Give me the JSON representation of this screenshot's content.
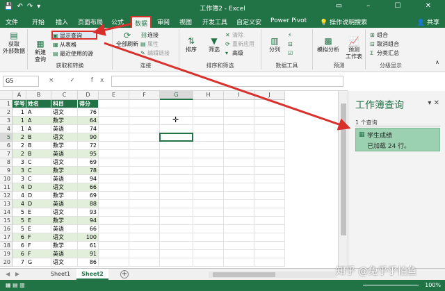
{
  "window": {
    "title": "工作簿2 - Excel"
  },
  "tabs": {
    "file": "文件",
    "home": "开始",
    "insert": "插入",
    "layout": "页面布局",
    "formulas": "公式",
    "data": "数据",
    "review": "审阅",
    "view": "视图",
    "developer": "开发工具",
    "custom": "自定义安",
    "powerpivot": "Power Pivot",
    "tellme": "操作说明搜索",
    "share": "共享"
  },
  "ribbon": {
    "get_external": "获取\n外部数据",
    "new_query": "新建\n查询",
    "show_queries": "显示查询",
    "from_table": "从表格",
    "recent_sources": "最近使用的源",
    "group_get_transform": "获取和转换",
    "refresh_all": "全部刷新",
    "connections": "连接",
    "properties": "属性",
    "edit_links": "编辑链接",
    "group_connections": "连接",
    "sort": "排序",
    "filter": "筛选",
    "clear": "清除",
    "reapply": "重新应用",
    "advanced": "高级",
    "group_sort_filter": "排序和筛选",
    "text_to_columns": "分列",
    "group_data_tools": "数据工具",
    "what_if": "模拟分析",
    "forecast_sheet": "预测\n工作表",
    "group_forecast": "预测",
    "group_btn": "组合",
    "ungroup_btn": "取消组合",
    "subtotal": "分类汇总",
    "group_outline": "分级显示"
  },
  "formula_bar": {
    "name_box": "G5",
    "fx_icons": "× ✓ fx"
  },
  "columns": [
    "A",
    "B",
    "C",
    "D",
    "E",
    "F",
    "G",
    "H",
    "I",
    "J"
  ],
  "table": {
    "headers": [
      "学号",
      "姓名",
      "科目",
      "得分"
    ],
    "rows": [
      [
        "1",
        "A",
        "语文",
        "76"
      ],
      [
        "1",
        "A",
        "数学",
        "64"
      ],
      [
        "1",
        "A",
        "英语",
        "74"
      ],
      [
        "2",
        "B",
        "语文",
        "90"
      ],
      [
        "2",
        "B",
        "数学",
        "72"
      ],
      [
        "2",
        "B",
        "英语",
        "95"
      ],
      [
        "3",
        "C",
        "语文",
        "69"
      ],
      [
        "3",
        "C",
        "数学",
        "78"
      ],
      [
        "3",
        "C",
        "英语",
        "94"
      ],
      [
        "4",
        "D",
        "语文",
        "66"
      ],
      [
        "4",
        "D",
        "数学",
        "69"
      ],
      [
        "4",
        "D",
        "英语",
        "88"
      ],
      [
        "5",
        "E",
        "语文",
        "93"
      ],
      [
        "5",
        "E",
        "数学",
        "94"
      ],
      [
        "5",
        "E",
        "英语",
        "66"
      ],
      [
        "6",
        "F",
        "语文",
        "100"
      ],
      [
        "6",
        "F",
        "数学",
        "61"
      ],
      [
        "6",
        "F",
        "英语",
        "91"
      ],
      [
        "7",
        "G",
        "语文",
        "86"
      ]
    ]
  },
  "row_numbers": [
    "1",
    "2",
    "3",
    "4",
    "5",
    "6",
    "7",
    "8",
    "9",
    "10",
    "11",
    "12",
    "13",
    "14",
    "15",
    "16",
    "17",
    "18",
    "19",
    "20"
  ],
  "pane": {
    "title": "工作簿查询",
    "count": "1 个查询",
    "query_name": "学生成绩",
    "query_status": "已加载 24 行。"
  },
  "sheets": {
    "sheet1": "Sheet1",
    "sheet2": "Sheet2"
  },
  "status": {
    "zoom": "100%"
  },
  "watermark": "知乎 @兔乎乎怕鱼",
  "colors": {
    "accent": "#217346",
    "highlight": "#d9302c",
    "band": "#e2efda"
  }
}
